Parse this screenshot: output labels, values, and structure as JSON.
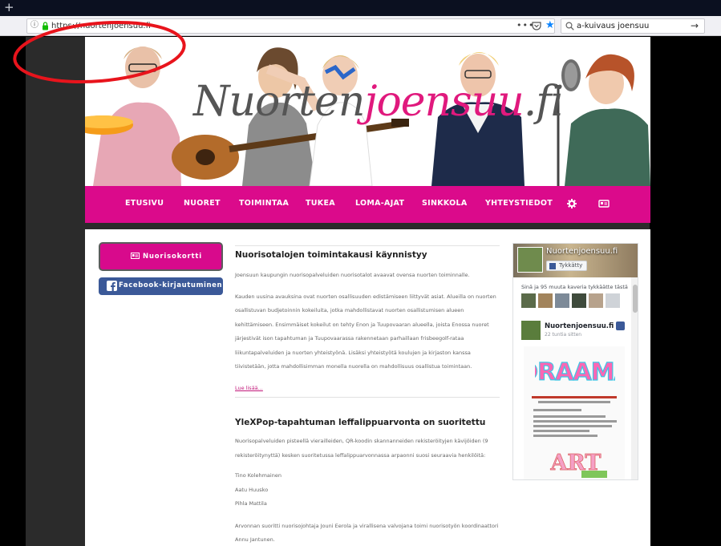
{
  "browser": {
    "new_tab_glyph": "+",
    "url": "https://nuortenjoensuu.fi",
    "page_actions_glyph": "•••",
    "search_query": "a-kuivaus joensuu",
    "go_glyph": "→"
  },
  "site": {
    "logo_part1": "Nuorten",
    "logo_part2": "joensuu",
    "logo_part3": ".fi"
  },
  "menu": {
    "items": [
      "ETUSIVU",
      "NUORET",
      "TOIMINTAA",
      "TUKEA",
      "LOMA-AJAT",
      "SINKKOLA",
      "YHTEYSTIEDOT"
    ],
    "icons": [
      "gear-icon",
      "id-card-icon"
    ],
    "colors": {
      "accent": "#db0a8b"
    }
  },
  "sidebar": {
    "card_button": "Nuorisokortti",
    "facebook_button": "Facebook-kirjautuminen"
  },
  "articles": [
    {
      "title": "Nuorisotalojen toimintakausi käynnistyy",
      "paragraphs": [
        "Joensuun kaupungin nuorisopalveluiden nuorisotalot avaavat ovensa nuorten toiminnalle.",
        "Kauden uusina avauksina ovat nuorten osallisuuden edistämiseen liittyvät asiat. Alueilla on nuorten osallistuvan budjetoinnin kokeiluita, jotka mahdollistavat nuorten osallistumisen alueen kehittämiseen. Ensimmäiset kokeilut on tehty Enon ja Tuupovaaran alueella, joista Enossa nuoret järjestivät ison tapahtuman ja Tuupovaarassa rakennetaan parhaillaan frisbeegolf-rataa liikuntapalveluiden ja nuorten yhteistyönä. Lisäksi yhteistyötä koulujen ja kirjaston kanssa tiivistetään, jotta mahdollisimman monella nuorella on mahdollisuus osallistua toimintaan."
      ],
      "read_more": "Lue lisää..."
    },
    {
      "title": "YleXPop-tapahtuman leffalippuarvonta on suoritettu",
      "paragraphs": [
        "Nuorisopalveluiden pisteellä vierailleiden, QR-koodin skannanneiden rekisteröityjen kävijöiden (9 rekisteröitynyttä) kesken suoritetussa leffalippuarvonnassa arpaonni suosi seuraavia henkilöitä:"
      ],
      "winners": [
        "Tino Kolehmainen",
        "Aatu Huusko",
        "Pihla Mattila"
      ],
      "closing": "Arvonnan suoritti nuorisojohtaja Jouni Eerola ja virallisena valvojana toimi nuorisotyön koordinaattori Annu Jantunen."
    }
  ],
  "facebook_widget": {
    "page_name": "Nuortenjoensuu.fi",
    "like_label": "Tykkätty",
    "friends_text": "Sinä ja 95 muuta kaveria tykkäätte tästä",
    "post_author": "Nuortenjoensuu.fi",
    "post_time": "22 tuntia sitten",
    "poster_word1": "DRAAMA",
    "poster_word2": "ART"
  }
}
